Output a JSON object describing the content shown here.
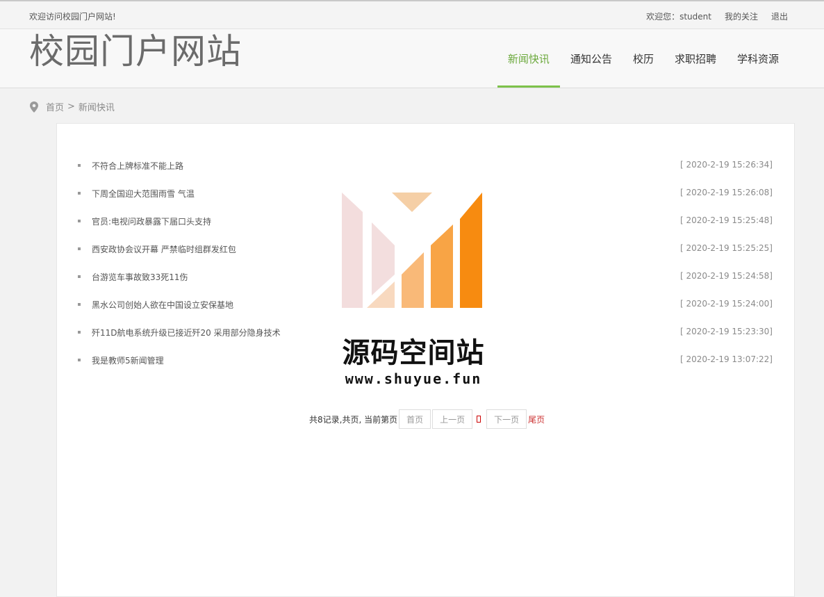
{
  "topbar": {
    "welcome_text": "欢迎访问校园门户网站!",
    "user_greeting": "欢迎您：student",
    "my_follow": "我的关注",
    "logout": "退出"
  },
  "header": {
    "site_title": "校园门户网站",
    "nav": [
      {
        "label": "新闻快讯",
        "active": true
      },
      {
        "label": "通知公告"
      },
      {
        "label": "校历"
      },
      {
        "label": "求职招聘"
      },
      {
        "label": "学科资源"
      }
    ]
  },
  "breadcrumb": {
    "icon": "location-pin-icon",
    "home": "首页",
    "separator": ">",
    "current": "新闻快讯"
  },
  "news": [
    {
      "title": "不符合上牌标准不能上路",
      "time": "[ 2020-2-19 15:26:34]"
    },
    {
      "title": "下周全国迎大范围雨雪 气温",
      "time": "[ 2020-2-19 15:26:08]"
    },
    {
      "title": "官员:电视问政暴露下届口头支持",
      "time": "[ 2020-2-19 15:25:48]"
    },
    {
      "title": "西安政协会议开幕 严禁临时组群发红包",
      "time": "[ 2020-2-19 15:25:25]"
    },
    {
      "title": "台游览车事故致33死11伤",
      "time": "[ 2020-2-19 15:24:58]"
    },
    {
      "title": "黑水公司创始人欲在中国设立安保基地",
      "time": "[ 2020-2-19 15:24:00]"
    },
    {
      "title": "歼11D航电系统升级已接近歼20 采用部分隐身技术",
      "time": "[ 2020-2-19 15:23:30]"
    },
    {
      "title": "我是教师5新闻管理",
      "time": "[ 2020-2-19 13:07:22]"
    }
  ],
  "pager": {
    "summary": "共8记录,共页, 当前第页",
    "first": "首页",
    "prev": "上一页",
    "next": "下一页",
    "last": "尾页"
  },
  "watermark": {
    "title": "源码空间站",
    "url": "www.shuyue.fun"
  },
  "colors": {
    "accent": "#7dc24b",
    "accent_text": "#6aa83a",
    "last_link": "#cc3333"
  }
}
